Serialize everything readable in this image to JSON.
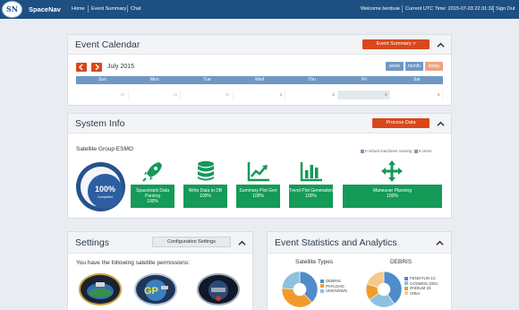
{
  "navbar": {
    "brand": "SpaceNav",
    "logo_text": "SN",
    "links": [
      "Home",
      "Event Summary",
      "Chat"
    ],
    "welcome": "Welcome benbuie",
    "utc_time": "Current UTC Time: 2015-07-03 22:31:32",
    "signout": "Sign Out"
  },
  "event_calendar": {
    "title": "Event Calendar",
    "summary_button": "Event Summary >",
    "month": "July 2015",
    "view_buttons": [
      "week",
      "month",
      "today"
    ],
    "weekdays": [
      "Sun",
      "Mon",
      "Tue",
      "Wed",
      "Thu",
      "Fri",
      "Sat"
    ],
    "first_row": [
      "28",
      "29",
      "30",
      "1",
      "2",
      "3",
      "4"
    ]
  },
  "system_info": {
    "title": "System Info",
    "process_button": "Process Data",
    "satellite_group": "Satellite Group ESMO",
    "vm_running": "0 virtual machines running",
    "cores": "0 cores",
    "completion_percent": "100%",
    "completion_label": "Completed",
    "tasks": [
      {
        "label": "Spacetrack Data Parsing",
        "value": "100%",
        "icon": "rocket-icon"
      },
      {
        "label": "Write Data to DB",
        "value": "100%",
        "icon": "database-icon"
      },
      {
        "label": "Summary Plot Gen",
        "value": "100%",
        "icon": "line-chart-icon"
      },
      {
        "label": "Trend Plot Generation",
        "value": "100%",
        "icon": "bar-chart-icon"
      },
      {
        "label": "Maneuver Planning",
        "value": "100%",
        "icon": "move-arrows-icon"
      }
    ],
    "colors": {
      "task_green": "#159a58",
      "ring_blue": "#2c5ea1",
      "accent_orange": "#d9481d"
    }
  },
  "settings": {
    "title": "Settings",
    "config_button": "Configuration Settings",
    "permissions_text": "You have the following satellite permissions:"
  },
  "analytics": {
    "title": "Event Statistics and Analytics",
    "chart_data": [
      {
        "type": "pie",
        "title": "Satellite Types",
        "categories": [
          "DEBRIS",
          "PAYLOAD",
          "UNKNOWN"
        ],
        "values": [
          38,
          38,
          24
        ],
        "colors": [
          "#4f8cc9",
          "#f29b2b",
          "#8cc1e0"
        ]
      },
      {
        "type": "pie",
        "title": "DEBRIS",
        "categories": [
          "FENGYUN 1C",
          "COSMOS 2251",
          "IRIDIUM 33",
          "Other"
        ],
        "values": [
          40,
          25,
          15,
          20
        ],
        "colors": [
          "#4f8cc9",
          "#8cc1e0",
          "#f29b2b",
          "#f6c98a"
        ]
      }
    ]
  }
}
